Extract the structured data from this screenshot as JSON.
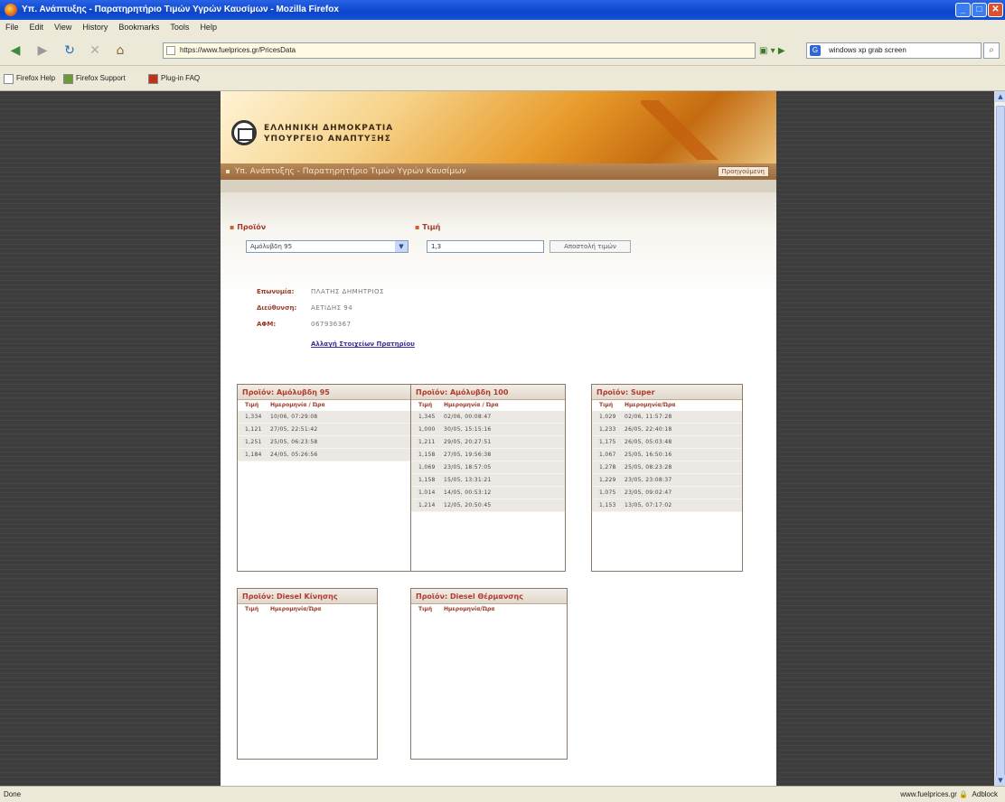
{
  "window": {
    "title": "Υπ. Ανάπτυξης - Παρατηρητήριο Τιμών Υγρών Καυσίμων - Mozilla Firefox",
    "controls": {
      "minimize": "_",
      "maximize": "□",
      "close": "✕"
    }
  },
  "menu": [
    "File",
    "Edit",
    "View",
    "History",
    "Bookmarks",
    "Tools",
    "Help"
  ],
  "navbar": {
    "url": "https://www.fuelprices.gr/PricesData",
    "search_value": "windows xp grab screen"
  },
  "bookmarks": [
    "Firefox Help",
    "Firefox Support",
    "Plug-in FAQ"
  ],
  "page": {
    "banner_line1": "ΕΛΛΗΝΙΚΗ ΔΗΜΟΚΡΑΤΙΑ",
    "banner_line2": "ΥΠΟΥΡΓΕΙΟ ΑΝΑΠΤΥΞΗΣ",
    "nav_title": "Υπ. Ανάπτυξης - Παρατηρητήριο Τιμών Υγρών Καυσίμων",
    "previous_button": "Προηγούμενη",
    "form": {
      "product_label": "Προϊόν",
      "product_selected": "Αμόλυβδη 95",
      "price_label": "Τιμή",
      "price_value": "1,3",
      "send_button": "Αποστολή τιμών"
    },
    "station": {
      "name_label": "Επωνυμία:",
      "name_value": "ΠΛΑΤΗΣ ΔΗΜΗΤΡΙΟΣ",
      "address_label": "Διεύθυνση:",
      "address_value": "ΑΕΤΙΔΗΣ 94",
      "afm_label": "ΑΦΜ:",
      "afm_value": "067936367",
      "change_link": "Αλλαγή Στοιχείων Πρατηρίου"
    },
    "boxes": [
      {
        "title": "Προϊόν: Αμόλυβδη 95",
        "col_price": "Τιμή",
        "col_date": "Ημερομηνία / Ώρα",
        "rows": [
          {
            "price": "1,334",
            "date": "10/06, 07:29:08"
          },
          {
            "price": "1,121",
            "date": "27/05, 22:51:42"
          },
          {
            "price": "1,251",
            "date": "25/05, 06:23:58"
          },
          {
            "price": "1,184",
            "date": "24/05, 05:26:56"
          }
        ]
      },
      {
        "title": "Προϊόν: Αμόλυβδη 100",
        "col_price": "Τιμή",
        "col_date": "Ημερομηνία / Ώρα",
        "rows": [
          {
            "price": "1,345",
            "date": "02/06, 00:08:47"
          },
          {
            "price": "1,000",
            "date": "30/05, 15:15:16"
          },
          {
            "price": "1,211",
            "date": "29/05, 20:27:51"
          },
          {
            "price": "1,158",
            "date": "27/05, 19:56:38"
          },
          {
            "price": "1,069",
            "date": "23/05, 18:57:05"
          },
          {
            "price": "1,158",
            "date": "15/05, 13:31:21"
          },
          {
            "price": "1,014",
            "date": "14/05, 00:53:12"
          },
          {
            "price": "1,214",
            "date": "12/05, 20:50:45"
          }
        ]
      },
      {
        "title": "Προϊόν: Super",
        "col_price": "Τιμή",
        "col_date": "Ημερομηνία/Ώρα",
        "rows": [
          {
            "price": "1,029",
            "date": "02/06, 11:57:28"
          },
          {
            "price": "1,233",
            "date": "26/05, 22:40:18"
          },
          {
            "price": "1,175",
            "date": "26/05, 05:03:48"
          },
          {
            "price": "1,067",
            "date": "25/05, 16:50:16"
          },
          {
            "price": "1,278",
            "date": "25/05, 08:23:28"
          },
          {
            "price": "1,229",
            "date": "23/05, 23:08:37"
          },
          {
            "price": "1,075",
            "date": "23/05, 09:02:47"
          },
          {
            "price": "1,153",
            "date": "13/05, 07:17:02"
          }
        ]
      },
      {
        "title": "Προϊόν: Diesel Κίνησης",
        "col_price": "Τιμή",
        "col_date": "Ημερομηνία/Ώρα",
        "rows": []
      },
      {
        "title": "Προϊόν: Diesel Θέρμανσης",
        "col_price": "Τιμή",
        "col_date": "Ημερομηνία/Ώρα",
        "rows": []
      }
    ]
  },
  "status": {
    "left": "Done",
    "right": "www.fuelprices.gr",
    "addon": "Adblock"
  }
}
